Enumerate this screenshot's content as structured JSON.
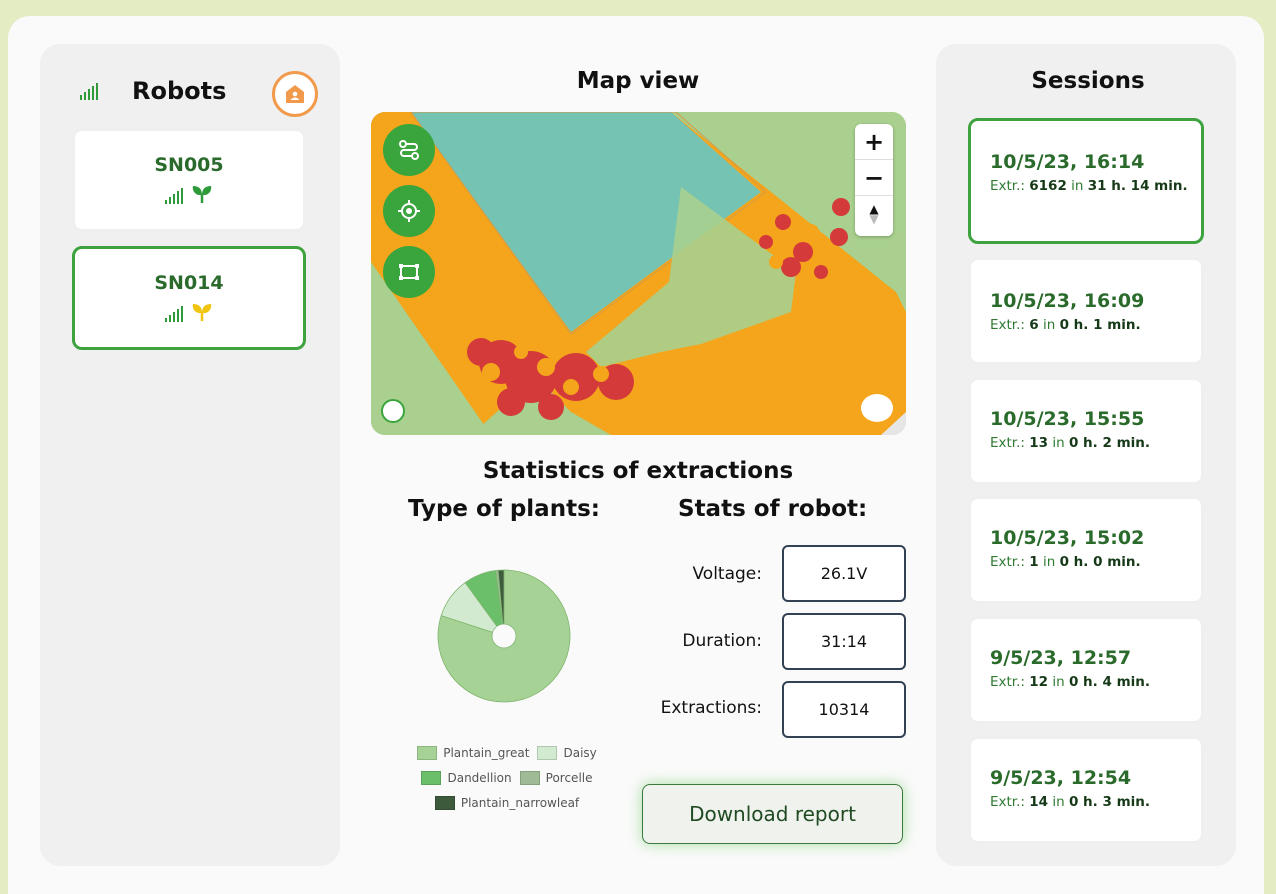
{
  "robots": {
    "title": "Robots",
    "items": [
      {
        "name": "SN005",
        "plant_color": "#2f9a3a"
      },
      {
        "name": "SN014",
        "plant_color": "#f1c40f"
      }
    ]
  },
  "map": {
    "title": "Map view",
    "zoom_in": "+",
    "zoom_out": "−"
  },
  "stats": {
    "title": "Statistics of extractions",
    "plants_title": "Type of plants:",
    "robot_title": "Stats of robot:",
    "voltage_label": "Voltage:",
    "voltage_value": "26.1V",
    "duration_label": "Duration:",
    "duration_value": "31:14",
    "extractions_label": "Extractions:",
    "extractions_value": "10314"
  },
  "chart_data": {
    "type": "pie",
    "series": [
      {
        "name": "Plantain_great",
        "value": 80,
        "color": "#a6d395"
      },
      {
        "name": "Daisy",
        "value": 10,
        "color": "#d2ead0"
      },
      {
        "name": "Dandellion",
        "value": 8,
        "color": "#6cbf6a"
      },
      {
        "name": "Porcelle",
        "value": 0.6,
        "color": "#9ebb96"
      },
      {
        "name": "Plantain_narrowleaf",
        "value": 1.4,
        "color": "#3d5a3d"
      }
    ]
  },
  "download_label": "Download report",
  "sessions": {
    "title": "Sessions",
    "items": [
      {
        "date": "10/5/23, 16:14",
        "prefix": "Extr.:",
        "count": "6162",
        "in": "in",
        "duration": "31 h. 14 min."
      },
      {
        "date": "10/5/23, 16:09",
        "prefix": "Extr.:",
        "count": "6",
        "in": "in",
        "duration": "0 h. 1 min."
      },
      {
        "date": "10/5/23, 15:55",
        "prefix": "Extr.:",
        "count": "13",
        "in": "in",
        "duration": "0 h. 2 min."
      },
      {
        "date": "10/5/23, 15:02",
        "prefix": "Extr.:",
        "count": "1",
        "in": "in",
        "duration": "0 h. 0 min."
      },
      {
        "date": "9/5/23, 12:57",
        "prefix": "Extr.:",
        "count": "12",
        "in": "in",
        "duration": "0 h. 4 min."
      },
      {
        "date": "9/5/23, 12:54",
        "prefix": "Extr.:",
        "count": "14",
        "in": "in",
        "duration": "0 h. 3 min."
      }
    ]
  }
}
